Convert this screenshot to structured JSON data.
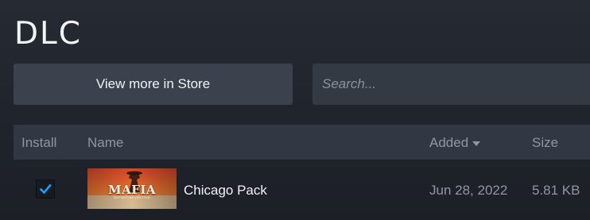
{
  "page": {
    "title": "DLC"
  },
  "toolbar": {
    "store_button_label": "View more in Store",
    "search_placeholder": "Search..."
  },
  "table": {
    "columns": {
      "install": "Install",
      "name": "Name",
      "added": "Added",
      "size": "Size"
    },
    "sort_column": "Added",
    "sort_direction": "descending",
    "rows": [
      {
        "installed": true,
        "thumbnail_text": "MAFIA",
        "thumbnail_subtext": "DEFINITIVE EDITION",
        "name": "Chicago Pack",
        "added": "Jun 28, 2022",
        "size": "5.81 KB"
      }
    ]
  },
  "colors": {
    "accent": "#1a9fff",
    "checkbox_bg": "#171a1f"
  }
}
